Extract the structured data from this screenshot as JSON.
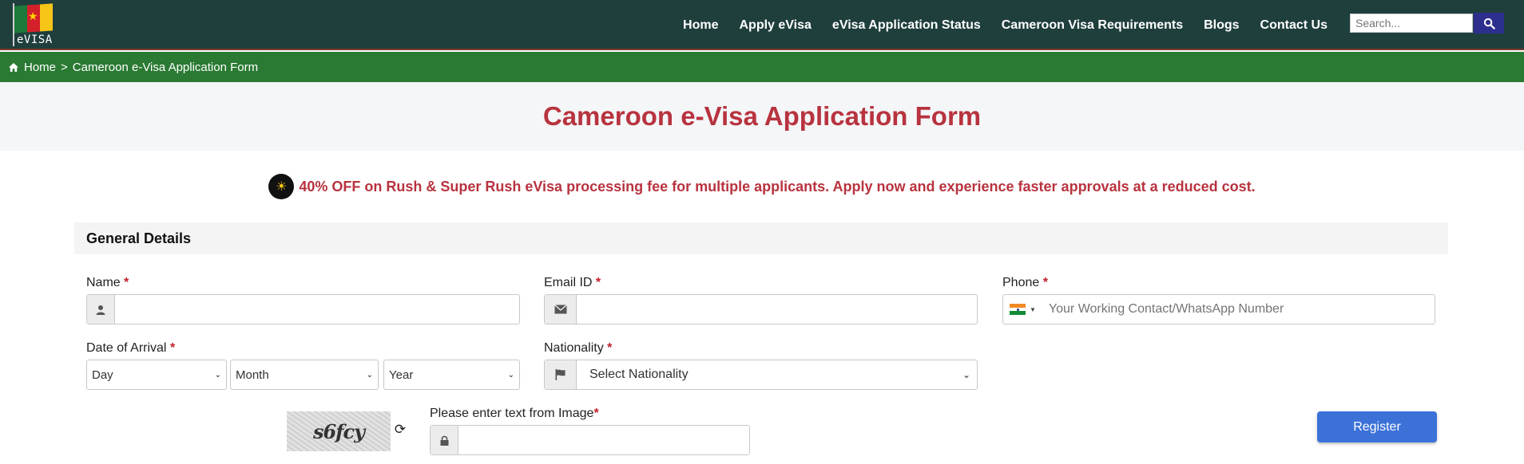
{
  "logo": {
    "text": "eVISA",
    "flag_colors": [
      "#1e7a3a",
      "#d4202a",
      "#f5c518"
    ]
  },
  "nav": {
    "items": [
      "Home",
      "Apply eVisa",
      "eVisa Application Status",
      "Cameroon Visa Requirements",
      "Blogs",
      "Contact Us"
    ]
  },
  "search": {
    "placeholder": "Search..."
  },
  "breadcrumb": {
    "home": "Home",
    "separator": ">",
    "current": "Cameroon e-Visa Application Form"
  },
  "page": {
    "title": "Cameroon e-Visa Application Form"
  },
  "promo": {
    "message": "40% OFF on Rush & Super Rush eVisa processing fee for multiple applicants. Apply now and experience faster approvals at a reduced cost."
  },
  "form": {
    "section_title": "General Details",
    "required_mark": "*",
    "name": {
      "label": "Name",
      "value": ""
    },
    "email": {
      "label": "Email ID",
      "value": ""
    },
    "phone": {
      "label": "Phone",
      "placeholder": "Your Working Contact/WhatsApp Number",
      "country": "India"
    },
    "arrival": {
      "label": "Date of Arrival",
      "day": "Day",
      "month": "Month",
      "year": "Year"
    },
    "nationality": {
      "label": "Nationality",
      "value": "Select Nationality"
    },
    "captcha": {
      "label": "Please enter text from Image",
      "image_text": "s6fcy",
      "value": ""
    },
    "register_label": "Register"
  },
  "colors": {
    "header": "#1f3f3d",
    "breadcrumb": "#2a7a33",
    "accent_red": "#b8333f",
    "register": "#3c72d8"
  }
}
